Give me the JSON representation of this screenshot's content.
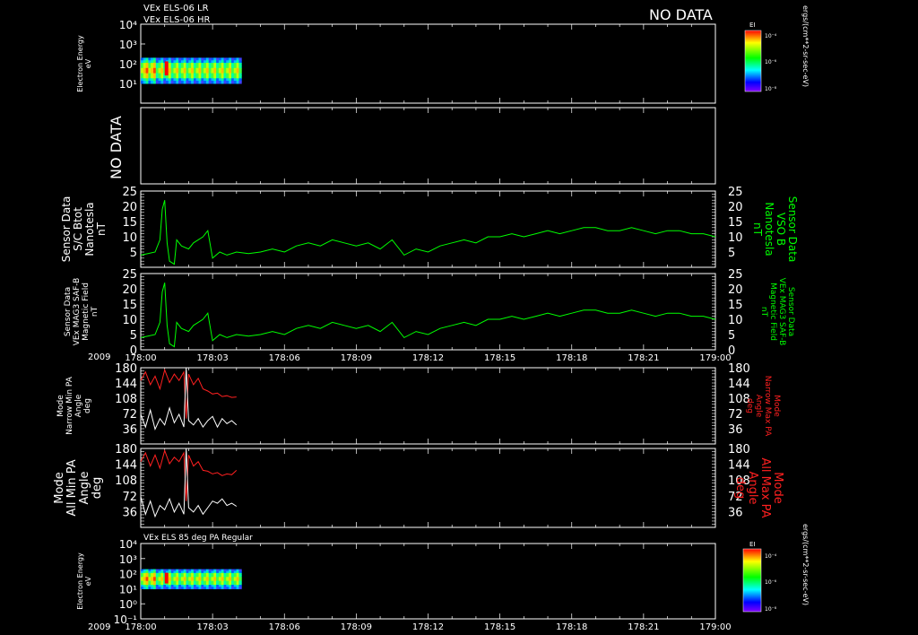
{
  "header": {
    "title_lines": [
      "VEx ELS-06 LR",
      "VEx ELS-06 HR"
    ],
    "no_data_label": "NO DATA"
  },
  "colorbar": {
    "label": "EI",
    "ticks": [
      "10⁻⁴",
      "10⁻⁶",
      "10⁻⁸"
    ],
    "unit_label": "ergs/(cm**2-sr-sec-eV)"
  },
  "footer": {
    "year_label": "2009",
    "bottom_title": "VEx ELS 85 deg PA Regular"
  },
  "colors": {
    "background": "#000000",
    "axis": "#ffffff",
    "green_series": "#00ff00",
    "red_series": "#ff2020",
    "white_series": "#ffffff"
  },
  "chart_data": [
    {
      "type": "heatmap",
      "panel": "els-lr-hr",
      "ylabel": [
        "Electron Energy",
        "eV"
      ],
      "yticks": [
        "10⁴",
        "10³",
        "10²",
        "10¹"
      ],
      "ylim_log10": [
        0,
        4
      ],
      "x_coverage": [
        "178:00",
        "178:04"
      ],
      "energy_range_log10": [
        1,
        2.3
      ]
    },
    {
      "type": "line",
      "panel": "empty",
      "no_data_label": "NO DATA"
    },
    {
      "type": "line",
      "panel": "mag-vso",
      "ylabel_left": [
        "Sensor Data",
        "S/C Btot",
        "Nanotesla",
        "nT"
      ],
      "ylabel_right": [
        "Sensor Data",
        "VSO B",
        "Nanotesla",
        "nT"
      ],
      "yticks": [
        5,
        10,
        15,
        20,
        25
      ],
      "ylim": [
        0,
        25
      ],
      "series": [
        {
          "x_minutes": [
            0,
            0.3,
            0.6,
            0.8,
            0.9,
            1.0,
            1.1,
            1.2,
            1.4,
            1.5,
            1.7,
            2.0,
            2.2,
            2.4,
            2.6,
            2.8,
            3.0,
            3.3,
            3.6,
            4.0,
            4.5,
            5.0,
            5.5,
            6.0,
            6.5,
            7.0,
            7.5,
            8.0,
            8.5,
            9.0,
            9.5,
            10.0,
            10.5,
            11.0,
            11.5,
            12.0,
            12.5,
            13.0,
            13.5,
            14.0,
            14.5,
            15.0,
            15.5,
            16.0,
            16.5,
            17.0,
            17.5,
            18.0,
            18.5,
            19.0,
            19.5,
            20.0,
            20.5,
            21.0,
            21.5,
            22.0,
            22.5,
            23.0,
            23.5,
            24.0
          ],
          "values": [
            4,
            4.5,
            5,
            9,
            19,
            22,
            8,
            2,
            1,
            9,
            7,
            6,
            8,
            9,
            10,
            12,
            3,
            5,
            4,
            5,
            4.5,
            5,
            6,
            5,
            7,
            8,
            7,
            9,
            8,
            7,
            8,
            6,
            9,
            4,
            6,
            5,
            7,
            8,
            9,
            8,
            10,
            10,
            11,
            10,
            11,
            12,
            11,
            12,
            13,
            13,
            12,
            12,
            13,
            12,
            11,
            12,
            12,
            11,
            11,
            10
          ]
        }
      ]
    },
    {
      "type": "line",
      "panel": "mag-saf-b",
      "ylabel_left": [
        "Sensor Data",
        "VEx MAG3 SAF-B",
        "Magnetic Field",
        "nT"
      ],
      "ylabel_right": [
        "Sensor Data",
        "VEx MAG3 SAF-B",
        "Magnetic Field",
        "nT"
      ],
      "yticks": [
        0,
        5,
        10,
        15,
        20,
        25
      ],
      "ylim": [
        0,
        25
      ],
      "series": [
        {
          "x_minutes": [
            0,
            0.3,
            0.6,
            0.8,
            0.9,
            1.0,
            1.1,
            1.2,
            1.4,
            1.5,
            1.7,
            2.0,
            2.2,
            2.4,
            2.6,
            2.8,
            3.0,
            3.3,
            3.6,
            4.0,
            4.5,
            5.0,
            5.5,
            6.0,
            6.5,
            7.0,
            7.5,
            8.0,
            8.5,
            9.0,
            9.5,
            10.0,
            10.5,
            11.0,
            11.5,
            12.0,
            12.5,
            13.0,
            13.5,
            14.0,
            14.5,
            15.0,
            15.5,
            16.0,
            16.5,
            17.0,
            17.5,
            18.0,
            18.5,
            19.0,
            19.5,
            20.0,
            20.5,
            21.0,
            21.5,
            22.0,
            22.5,
            23.0,
            23.5,
            24.0
          ],
          "values": [
            4,
            4.5,
            5,
            9,
            19,
            22,
            8,
            2,
            1,
            9,
            7,
            6,
            8,
            9,
            10,
            12,
            3,
            5,
            4,
            5,
            4.5,
            5,
            6,
            5,
            7,
            8,
            7,
            9,
            8,
            7,
            8,
            6,
            9,
            4,
            6,
            5,
            7,
            8,
            9,
            8,
            10,
            10,
            11,
            10,
            11,
            12,
            11,
            12,
            13,
            13,
            12,
            12,
            13,
            12,
            11,
            12,
            12,
            11,
            11,
            10
          ]
        }
      ]
    },
    {
      "type": "line",
      "panel": "narrow-pa",
      "ylabel_left": [
        "Mode",
        "Narrow Min PA",
        "Angle",
        "deg"
      ],
      "ylabel_right": [
        "Mode",
        "Narrow Max PA",
        "Angle",
        "deg"
      ],
      "yticks": [
        36,
        72,
        108,
        144,
        180
      ],
      "ylim": [
        0,
        180
      ],
      "series": [
        {
          "name_key": "max",
          "x_minutes": [
            0,
            0.2,
            0.4,
            0.6,
            0.8,
            1.0,
            1.2,
            1.4,
            1.6,
            1.8,
            1.9,
            2.0,
            2.2,
            2.4,
            2.6,
            2.8,
            3.0,
            3.2,
            3.4,
            3.6,
            3.8,
            4.0
          ],
          "values": [
            150,
            170,
            140,
            160,
            130,
            175,
            145,
            165,
            150,
            170,
            60,
            165,
            140,
            155,
            130,
            125,
            118,
            120,
            112,
            114,
            110,
            111
          ]
        },
        {
          "name_key": "min",
          "x_minutes": [
            0,
            0.2,
            0.4,
            0.6,
            0.8,
            1.0,
            1.2,
            1.4,
            1.6,
            1.8,
            1.9,
            2.0,
            2.2,
            2.4,
            2.6,
            2.8,
            3.0,
            3.2,
            3.4,
            3.6,
            3.8,
            4.0
          ],
          "values": [
            70,
            40,
            80,
            35,
            60,
            45,
            85,
            50,
            70,
            40,
            180,
            55,
            45,
            60,
            40,
            55,
            65,
            40,
            60,
            48,
            55,
            45
          ]
        }
      ]
    },
    {
      "type": "line",
      "panel": "all-pa",
      "ylabel_left": [
        "Mode",
        "All Min PA",
        "Angle",
        "deg"
      ],
      "ylabel_right": [
        "Mode",
        "All Max PA",
        "Angle",
        "deg"
      ],
      "yticks": [
        36,
        72,
        108,
        144,
        180
      ],
      "ylim": [
        0,
        180
      ],
      "series": [
        {
          "name_key": "max",
          "x_minutes": [
            0,
            0.2,
            0.4,
            0.6,
            0.8,
            1.0,
            1.2,
            1.4,
            1.6,
            1.8,
            1.9,
            2.0,
            2.2,
            2.4,
            2.6,
            2.8,
            3.0,
            3.2,
            3.4,
            3.6,
            3.8,
            4.0
          ],
          "values": [
            150,
            170,
            140,
            165,
            135,
            175,
            145,
            160,
            150,
            170,
            60,
            165,
            140,
            150,
            130,
            128,
            122,
            125,
            118,
            122,
            120,
            130
          ]
        },
        {
          "name_key": "min",
          "x_minutes": [
            0,
            0.2,
            0.4,
            0.6,
            0.8,
            1.0,
            1.2,
            1.4,
            1.6,
            1.8,
            1.9,
            2.0,
            2.2,
            2.4,
            2.6,
            2.8,
            3.0,
            3.2,
            3.4,
            3.6,
            3.8,
            4.0
          ],
          "values": [
            70,
            30,
            60,
            25,
            50,
            40,
            65,
            35,
            55,
            30,
            180,
            45,
            35,
            50,
            30,
            45,
            60,
            55,
            65,
            50,
            55,
            48
          ]
        }
      ]
    },
    {
      "type": "heatmap",
      "panel": "els-85deg",
      "ylabel": [
        "Electron Energy",
        "eV"
      ],
      "yticks": [
        "10⁴",
        "10³",
        "10²",
        "10¹",
        "10⁰",
        "10⁻¹"
      ],
      "ylim_log10": [
        -1,
        4
      ],
      "x_coverage": [
        "178:00",
        "178:04"
      ],
      "energy_range_log10": [
        1,
        2.3
      ]
    }
  ],
  "xaxis": {
    "ticks": [
      "178:00",
      "178:03",
      "178:06",
      "178:09",
      "178:12",
      "178:15",
      "178:18",
      "178:21",
      "179:00"
    ]
  }
}
